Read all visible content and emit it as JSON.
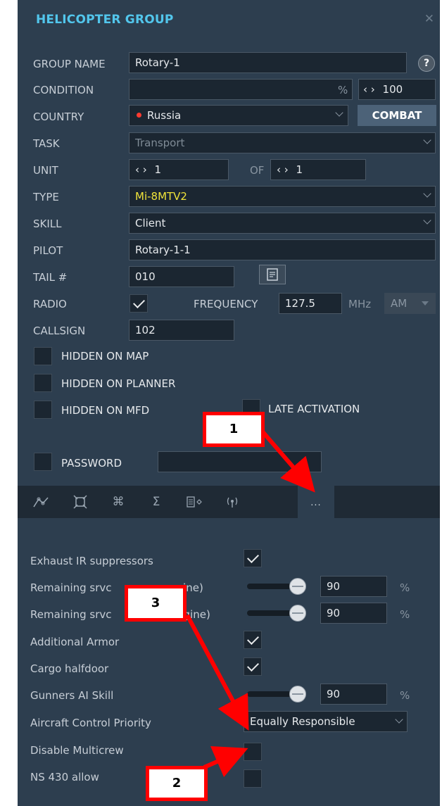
{
  "window": {
    "title": "HELICOPTER GROUP",
    "close_icon": "close-icon"
  },
  "group": {
    "name_label": "GROUP NAME",
    "name_value": "Rotary-1",
    "help_label": "?",
    "condition_label": "CONDITION",
    "condition_unit": "%",
    "condition_value": "100",
    "country_label": "COUNTRY",
    "country_value": "Russia",
    "country_color": "#ff3b30",
    "combat_label": "COMBAT",
    "task_label": "TASK",
    "task_value": "Transport",
    "unit_label": "UNIT",
    "unit_value": "1",
    "of_label": "OF",
    "of_value": "1",
    "type_label": "TYPE",
    "type_value": "Mi-8MTV2",
    "type_color": "#f0e33a",
    "skill_label": "SKILL",
    "skill_value": "Client",
    "pilot_label": "PILOT",
    "pilot_value": "Rotary-1-1",
    "tail_label": "TAIL #",
    "tail_value": "010",
    "radio_label": "RADIO",
    "radio_checked": true,
    "frequency_label": "FREQUENCY",
    "frequency_value": "127.5",
    "frequency_unit": "MHz",
    "modulation_value": "AM",
    "callsign_label": "CALLSIGN",
    "callsign_value": "102",
    "hidden_on_map_label": "HIDDEN ON MAP",
    "hidden_on_planner_label": "HIDDEN ON PLANNER",
    "hidden_on_mfd_label": "HIDDEN ON MFD",
    "late_activation_label": "LATE ACTIVATION",
    "password_label": "PASSWORD"
  },
  "tabs": [
    {
      "icon": "route-icon"
    },
    {
      "icon": "target-icon"
    },
    {
      "icon": "command-icon"
    },
    {
      "icon": "sigma-icon"
    },
    {
      "icon": "payload-icon"
    },
    {
      "icon": "radio-icon"
    },
    {
      "icon": "more-options-icon",
      "glyph": "..."
    }
  ],
  "options": {
    "exhaust_label": "Exhaust IR suppressors",
    "srv_left_label": "Remaining srvc",
    "srv_left_suffix": "gine)",
    "srv_left_value": "90",
    "srv_right_label": "Remaining srvc",
    "srv_right_suffix": "gine)",
    "srv_right_value": "90",
    "percent_unit": "%",
    "armor_label": "Additional Armor",
    "cargo_label": "Cargo halfdoor",
    "gunners_label": "Gunners AI Skill",
    "gunners_value": "90",
    "priority_label": "Aircraft Control Priority",
    "priority_value": "Equally Responsible",
    "multicrew_label": "Disable Multicrew",
    "ns430_label": "NS 430 allow"
  },
  "annotations": {
    "a1": "1",
    "a2": "2",
    "a3": "3",
    "color": "#ff0000"
  }
}
